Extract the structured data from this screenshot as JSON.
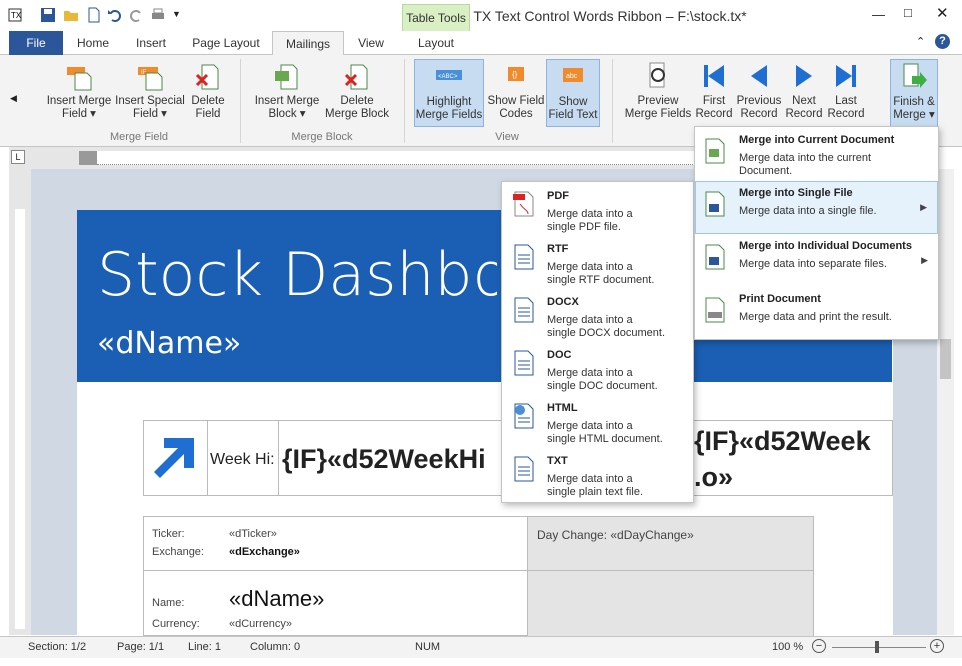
{
  "window": {
    "title": "TX Text Control Words Ribbon – F:\\stock.tx*",
    "context_tab": "Table Tools"
  },
  "tabs": [
    "File",
    "Home",
    "Insert",
    "Page Layout",
    "Mailings",
    "View",
    "Layout"
  ],
  "ribbon": {
    "merge_field": {
      "label": "Merge Field",
      "buttons": [
        {
          "l1": "Insert Merge",
          "l2": "Field ▾"
        },
        {
          "l1": "Insert Special",
          "l2": "Field ▾"
        },
        {
          "l1": "Delete",
          "l2": "Field"
        }
      ]
    },
    "merge_block": {
      "label": "Merge Block",
      "buttons": [
        {
          "l1": "Insert Merge",
          "l2": "Block ▾"
        },
        {
          "l1": "Delete",
          "l2": "Merge Block"
        }
      ]
    },
    "view": {
      "label": "View",
      "buttons": [
        {
          "l1": "Highlight",
          "l2": "Merge Fields"
        },
        {
          "l1": "Show Field",
          "l2": "Codes"
        },
        {
          "l1": "Show",
          "l2": "Field Text"
        }
      ]
    },
    "preview": {
      "buttons": [
        {
          "l1": "Preview",
          "l2": "Merge Fields"
        },
        {
          "l1": "First",
          "l2": "Record"
        },
        {
          "l1": "Previous",
          "l2": "Record"
        },
        {
          "l1": "Next",
          "l2": "Record"
        },
        {
          "l1": "Last",
          "l2": "Record"
        },
        {
          "l1": "Finish &",
          "l2": "Merge ▾"
        }
      ]
    }
  },
  "document": {
    "title": "Stock Dashboa",
    "name_field": "«dName»",
    "week_hi_label": "Week Hi:",
    "week_hi_field": "{IF}«d52WeekHi",
    "week_lo_field": "{IF}«d52Week",
    "lo_tail": ".o»",
    "ticker_label": "Ticker:",
    "ticker_value": "«dTicker»",
    "exchange_label": "Exchange:",
    "exchange_value": "«dExchange»",
    "day_change": "Day Change: «dDayChange»",
    "name_label": "Name:",
    "name_value": "«dName»",
    "currency_label": "Currency:",
    "currency_value": "«dCurrency»"
  },
  "finish_menu": [
    {
      "title": "Merge into Current Document",
      "desc1": "Merge data into the current",
      "desc2": "Document."
    },
    {
      "title": "Merge into Single File",
      "desc1": "Merge data into a single file.",
      "desc2": ""
    },
    {
      "title": "Merge into Individual Documents",
      "desc1": "Merge data into separate files.",
      "desc2": ""
    },
    {
      "title": "Print Document",
      "desc1": "Merge data and print the result.",
      "desc2": ""
    }
  ],
  "file_menu": [
    {
      "title": "PDF",
      "desc1": "Merge data into a",
      "desc2": "single PDF file."
    },
    {
      "title": "RTF",
      "desc1": "Merge data into a",
      "desc2": "single RTF document."
    },
    {
      "title": "DOCX",
      "desc1": "Merge data into a",
      "desc2": "single DOCX document."
    },
    {
      "title": "DOC",
      "desc1": "Merge data into a",
      "desc2": "single DOC document."
    },
    {
      "title": "HTML",
      "desc1": "Merge data into a",
      "desc2": "single HTML document."
    },
    {
      "title": "TXT",
      "desc1": "Merge data into a",
      "desc2": "single plain text file."
    }
  ],
  "status": {
    "section": "Section: 1/2",
    "page": "Page: 1/1",
    "line": "Line: 1",
    "column": "Column: 0",
    "num": "NUM",
    "zoom": "100 %"
  },
  "colors": {
    "accent": "#2b579a",
    "banner": "#1a5fb4",
    "context": "#d9efc4"
  }
}
